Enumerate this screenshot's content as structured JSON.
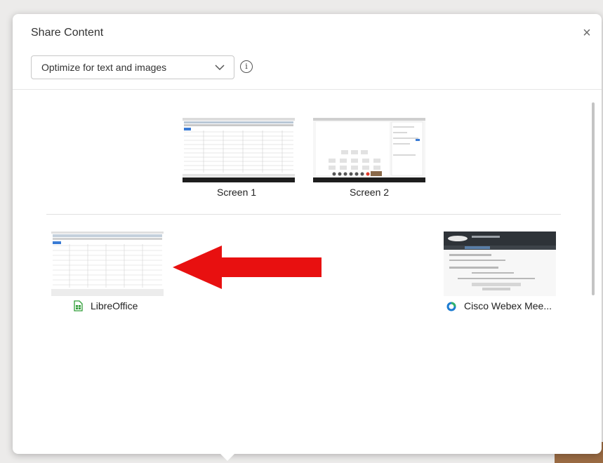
{
  "dialog": {
    "title": "Share Content",
    "close_label": "×",
    "optimize_dropdown": {
      "selected": "Optimize for text and images"
    },
    "info_label": "i"
  },
  "screens": [
    {
      "label": "Screen 1"
    },
    {
      "label": "Screen 2"
    }
  ],
  "apps": [
    {
      "label": "LibreOffice",
      "icon": "libreoffice-calc-icon"
    },
    {
      "label": "Cisco Webex Mee...",
      "icon": "webex-icon"
    }
  ],
  "colors": {
    "arrow": "#e81010",
    "calc_green": "#2e9d36",
    "webex_blue": "#1c7bd1"
  }
}
